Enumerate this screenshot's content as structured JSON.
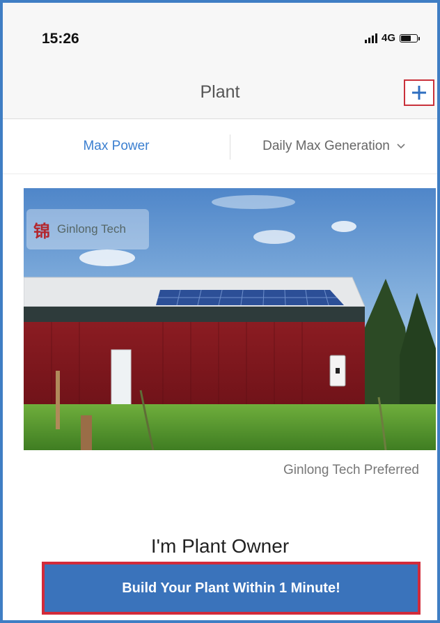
{
  "status_bar": {
    "time": "15:26",
    "network": "4G",
    "icons": [
      "signal-icon",
      "battery-icon"
    ]
  },
  "navbar": {
    "title": "Plant",
    "add_icon": "plus-icon",
    "accent_color": "#3b7fd0",
    "highlight_color": "#c9313b"
  },
  "tabs": {
    "left_label": "Max Power",
    "right_label": "Daily Max Generation",
    "right_icon": "chevron-down-icon"
  },
  "plant_card": {
    "logo_text": "Ginlong Tech",
    "caption": "Ginlong Tech Preferred"
  },
  "owner_section": {
    "title": "I'm Plant Owner",
    "button_label": "Build Your Plant Within 1 Minute!",
    "button_color": "#3a73bb",
    "button_border_color": "#d22b3a"
  }
}
